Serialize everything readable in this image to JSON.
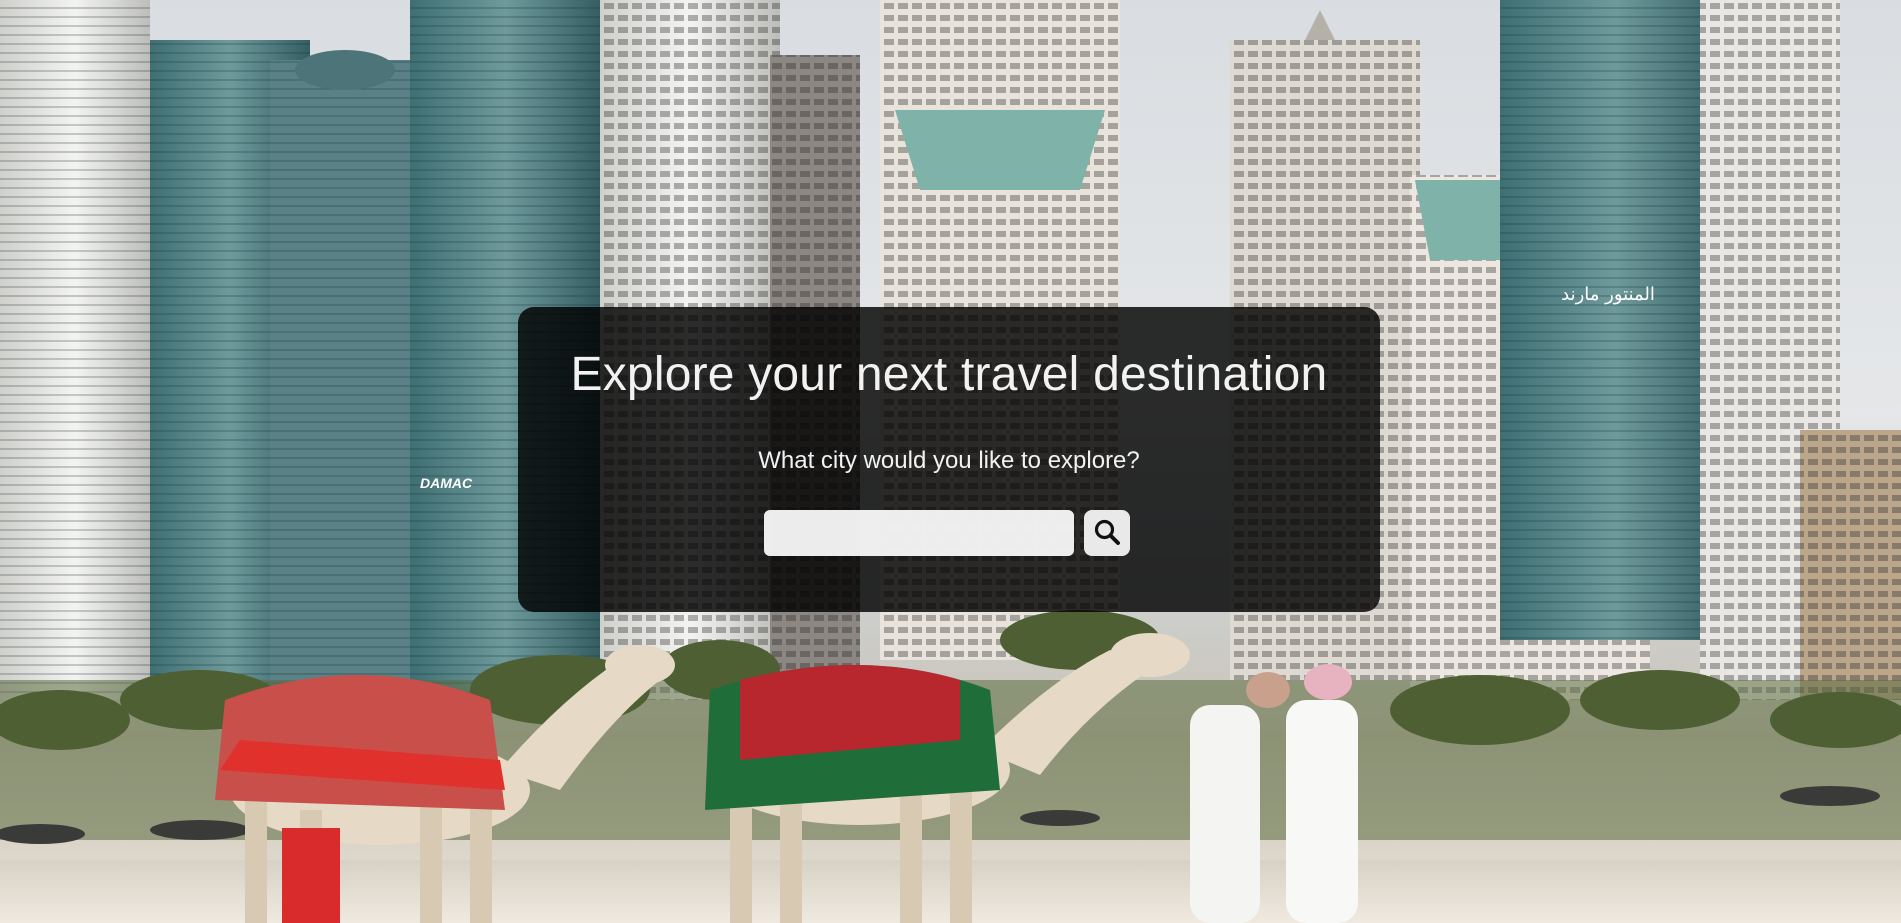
{
  "hero": {
    "heading": "Explore your next travel destination",
    "prompt": "What city would you like to explore?"
  },
  "search": {
    "value": "",
    "placeholder": "",
    "button_icon": "search-icon"
  },
  "background": {
    "building_signs": [
      "DAMAC",
      "المنتور مارند"
    ]
  },
  "colors": {
    "panel_bg": "#000000",
    "heading_text": "#f2f2f2",
    "button_bg": "#e9e9e9"
  }
}
